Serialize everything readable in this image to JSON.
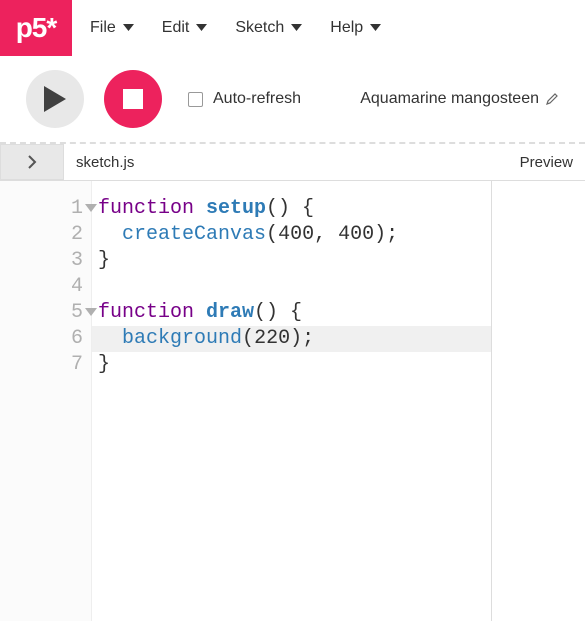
{
  "logo": "p5*",
  "menu": {
    "file": "File",
    "edit": "Edit",
    "sketch": "Sketch",
    "help": "Help"
  },
  "toolbar": {
    "autorefresh_label": "Auto-refresh",
    "sketch_name": "Aquamarine mangosteen",
    "autorefresh_checked": false
  },
  "tabs": {
    "filename": "sketch.js",
    "preview": "Preview"
  },
  "editor": {
    "highlighted_line": 6,
    "foldable_lines": [
      1,
      5
    ],
    "lines": [
      {
        "n": 1,
        "tokens": [
          [
            "kw",
            "function"
          ],
          [
            "sp",
            " "
          ],
          [
            "fn",
            "setup"
          ],
          [
            "pn",
            "() {"
          ]
        ]
      },
      {
        "n": 2,
        "tokens": [
          [
            "sp",
            "  "
          ],
          [
            "call",
            "createCanvas"
          ],
          [
            "pn",
            "("
          ],
          [
            "num",
            "400"
          ],
          [
            "pn",
            ", "
          ],
          [
            "num",
            "400"
          ],
          [
            "pn",
            ");"
          ]
        ]
      },
      {
        "n": 3,
        "tokens": [
          [
            "pn",
            "}"
          ]
        ]
      },
      {
        "n": 4,
        "tokens": []
      },
      {
        "n": 5,
        "tokens": [
          [
            "kw",
            "function"
          ],
          [
            "sp",
            " "
          ],
          [
            "fn",
            "draw"
          ],
          [
            "pn",
            "() {"
          ]
        ]
      },
      {
        "n": 6,
        "tokens": [
          [
            "sp",
            "  "
          ],
          [
            "call",
            "background"
          ],
          [
            "pn",
            "("
          ],
          [
            "num",
            "220"
          ],
          [
            "pn",
            ");"
          ]
        ]
      },
      {
        "n": 7,
        "tokens": [
          [
            "pn",
            "}"
          ]
        ]
      }
    ]
  },
  "colors": {
    "brand": "#ed225d"
  }
}
